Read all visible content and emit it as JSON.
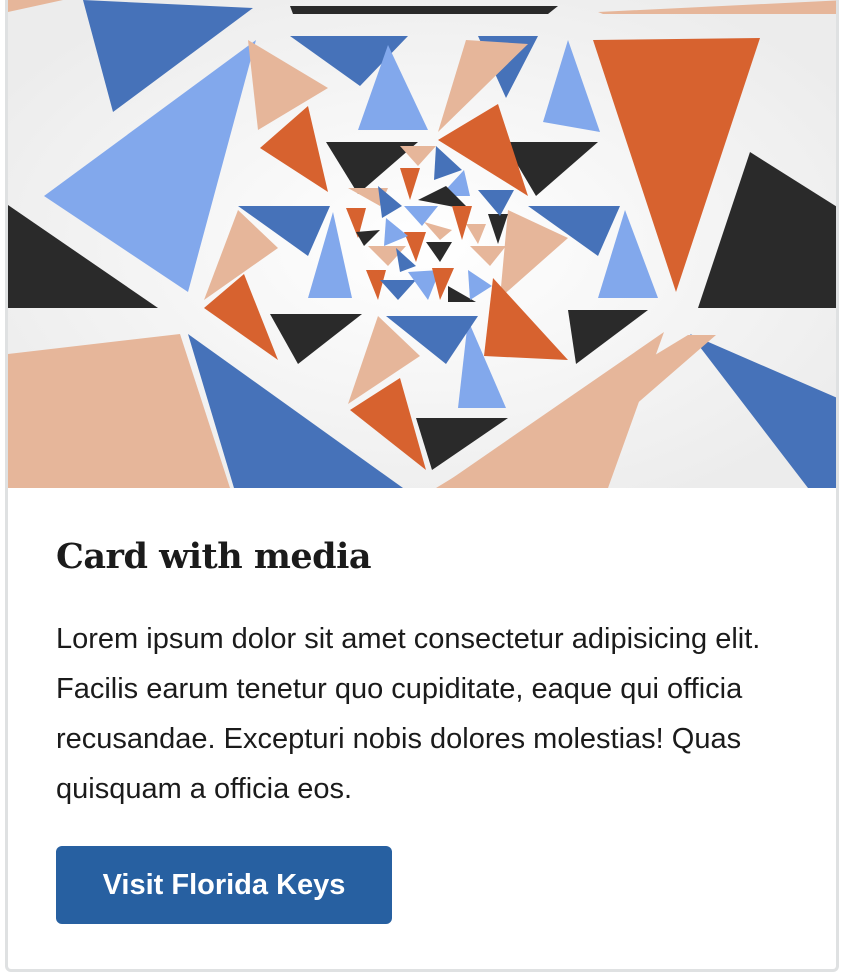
{
  "card": {
    "title": "Card with media",
    "text": "Lorem ipsum dolor sit amet consectetur adipisicing elit. Facilis earum tenetur quo cupiditate, eaque qui officia recusandae. Excepturi nobis dolores molestias! Quas quisquam a officia eos.",
    "button_label": "Visit Florida Keys"
  },
  "colors": {
    "button_background": "#2760a1",
    "text": "#1b1b1b",
    "card_border": "#dfe1e2",
    "media_background": "#f3f3f3",
    "triangle_palette": [
      "#4672b9",
      "#82a8ec",
      "#e6b69a",
      "#d7622f",
      "#2a2a2a"
    ]
  }
}
